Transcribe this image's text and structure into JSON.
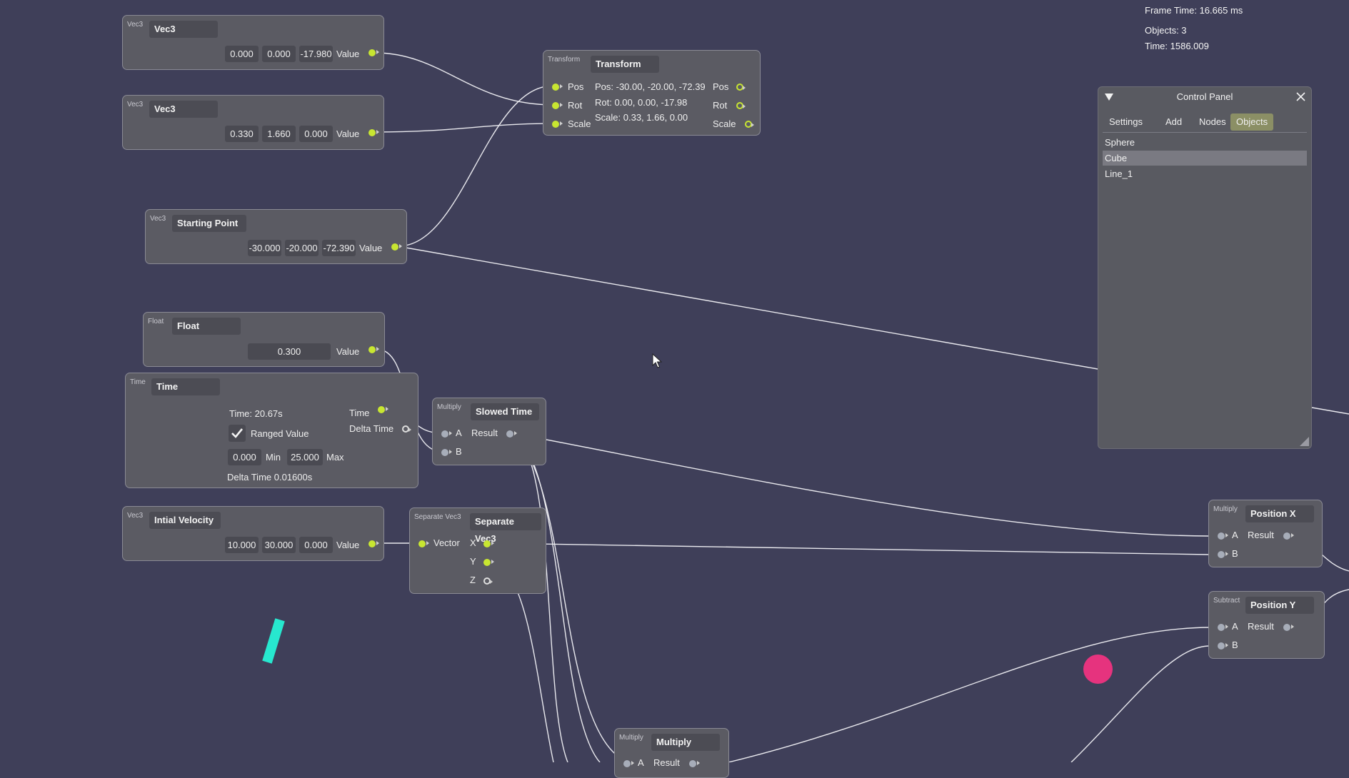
{
  "hud": {
    "frame_time": "Frame Time: 16.665 ms",
    "objects": "Objects: 3",
    "time": "Time: 1586.009"
  },
  "control_panel": {
    "title": "Control Panel",
    "tabs": [
      "Settings",
      "Add",
      "Nodes",
      "Objects"
    ],
    "active_tab": "Objects",
    "objects": [
      "Sphere",
      "Cube",
      "Line_1"
    ],
    "selected_object": "Cube"
  },
  "nodes": {
    "vec3_a": {
      "type": "Vec3",
      "title": "Vec3",
      "values": [
        "0.000",
        "0.000",
        "-17.980"
      ],
      "out_label": "Value"
    },
    "vec3_b": {
      "type": "Vec3",
      "title": "Vec3",
      "values": [
        "0.330",
        "1.660",
        "0.000"
      ],
      "out_label": "Value"
    },
    "starting_point": {
      "type": "Vec3",
      "title": "Starting Point",
      "values": [
        "-30.000",
        "-20.000",
        "-72.390"
      ],
      "out_label": "Value"
    },
    "float": {
      "type": "Float",
      "title": "Float",
      "value": "0.300",
      "out_label": "Value"
    },
    "time": {
      "type": "Time",
      "title": "Time",
      "time_text": "Time: 20.67s",
      "ranged_label": "Ranged Value",
      "ranged_checked": true,
      "min_value": "0.000",
      "min_label": "Min",
      "max_value": "25.000",
      "max_label": "Max",
      "delta_text": "Delta Time 0.01600s",
      "out_time": "Time",
      "out_delta": "Delta Time"
    },
    "initial_velocity": {
      "type": "Vec3",
      "title": "Intial Velocity",
      "values": [
        "10.000",
        "30.000",
        "0.000"
      ],
      "out_label": "Value"
    },
    "transform": {
      "type": "Transform",
      "title": "Transform",
      "in_pos": "Pos",
      "in_rot": "Rot",
      "in_scale": "Scale",
      "pos_text": "Pos: -30.00, -20.00, -72.39",
      "rot_text": "Rot: 0.00, 0.00, -17.98",
      "scale_text": "Scale: 0.33, 1.66, 0.00",
      "out_pos": "Pos",
      "out_rot": "Rot",
      "out_scale": "Scale"
    },
    "slowed_time": {
      "type": "Multiply",
      "title": "Slowed Time",
      "in_a": "A",
      "in_b": "B",
      "out": "Result"
    },
    "separate_vec3": {
      "type": "Separate Vec3",
      "title": "Separate Vec3",
      "in": "Vector",
      "out_x": "X",
      "out_y": "Y",
      "out_z": "Z"
    },
    "position_x": {
      "type": "Multiply",
      "title": "Position X",
      "in_a": "A",
      "in_b": "B",
      "out": "Result"
    },
    "position_y": {
      "type": "Subtract",
      "title": "Position Y",
      "in_a": "A",
      "in_b": "B",
      "out": "Result"
    },
    "multiply": {
      "type": "Multiply",
      "title": "Multiply",
      "in_a": "A",
      "out": "Result"
    }
  },
  "colors": {
    "background": "#3f3f59",
    "node": "#5b5b63",
    "port": "#c8e631",
    "sphere": "#e6337e",
    "cube": "#27e8cf"
  }
}
